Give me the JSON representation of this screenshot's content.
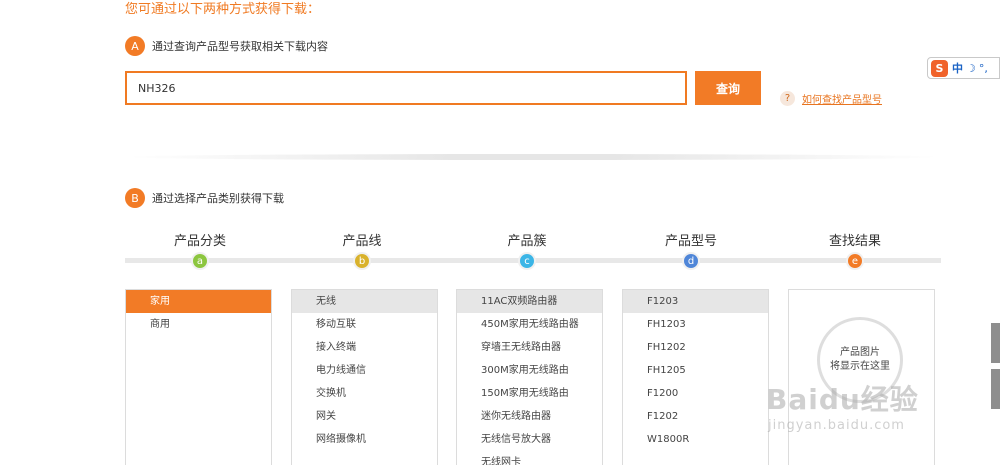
{
  "intro": "您可通过以下两种方式获得下载：",
  "section_a": {
    "badge": "A",
    "title": "通过查询产品型号获取相关下载内容"
  },
  "search": {
    "value": "NH326",
    "button": "查询"
  },
  "help": {
    "icon": "?",
    "link": "如何查找产品型号"
  },
  "section_b": {
    "badge": "B",
    "title": "通过选择产品类别获得下载"
  },
  "steps": [
    {
      "label": "产品分类",
      "marker": "a",
      "color": "#8cc63f"
    },
    {
      "label": "产品线",
      "marker": "b",
      "color": "#d9b22c"
    },
    {
      "label": "产品簇",
      "marker": "c",
      "color": "#3bb5e6"
    },
    {
      "label": "产品型号",
      "marker": "d",
      "color": "#4f86d8"
    },
    {
      "label": "查找结果",
      "marker": "e",
      "color": "#f27b26"
    }
  ],
  "panels": {
    "category": {
      "items": [
        "家用",
        "商用"
      ],
      "selected": 0
    },
    "product_line": {
      "items": [
        "无线",
        "移动互联",
        "接入终端",
        "电力线通信",
        "交换机",
        "网关",
        "网络摄像机"
      ],
      "selected": 0
    },
    "product_family": {
      "items": [
        "11AC双频路由器",
        "450M家用无线路由器",
        "穿墙王无线路由器",
        "300M家用无线路由",
        "150M家用无线路由",
        "迷你无线路由器",
        "无线信号放大器",
        "无线网卡"
      ],
      "selected": 0
    },
    "product_model": {
      "items": [
        "F1203",
        "FH1203",
        "FH1202",
        "FH1205",
        "F1200",
        "F1202",
        "W1800R"
      ],
      "selected": 0
    },
    "result": {
      "line1": "产品图片",
      "line2": "将显示在这里"
    }
  },
  "ime": {
    "logo": "S",
    "lang": "中",
    "moon": "☽",
    "dots": "°,"
  },
  "watermark": {
    "brand": "Baidu经验",
    "url": "jingyan.baidu.com"
  },
  "icons": [
    "help-icon",
    "sogou-ime-icon",
    "moon-icon"
  ]
}
